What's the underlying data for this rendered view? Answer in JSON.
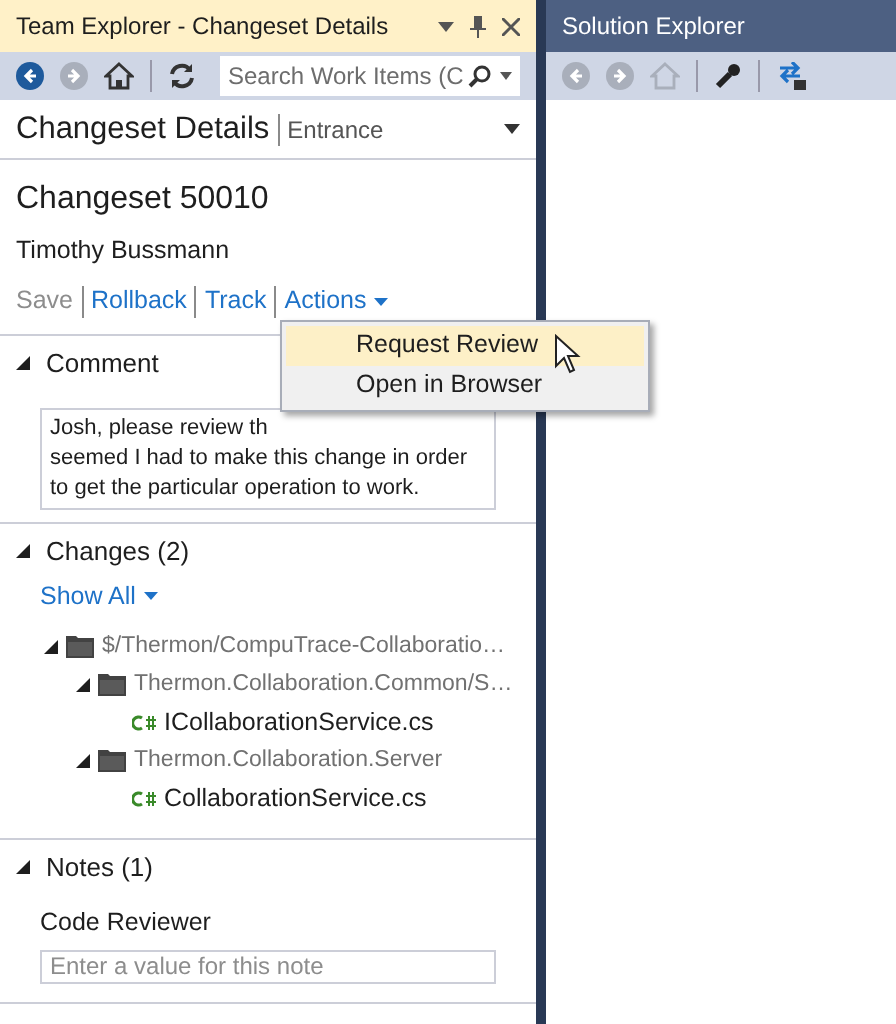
{
  "team_explorer": {
    "title": "Team Explorer - Changeset Details",
    "search": {
      "placeholder": "Search Work Items (C"
    },
    "page_title": "Changeset Details",
    "page_subtitle": "Entrance",
    "changeset": "Changeset 50010",
    "author": "Timothy Bussmann",
    "actions": [
      {
        "label": "Save",
        "disabled": true,
        "dropdown": false
      },
      {
        "label": "Rollback",
        "disabled": false,
        "dropdown": false
      },
      {
        "label": "Track",
        "disabled": false,
        "dropdown": false
      },
      {
        "label": "Actions",
        "disabled": false,
        "dropdown": true
      }
    ],
    "actions_menu": [
      {
        "label": "Request Review",
        "selected": true
      },
      {
        "label": "Open in Browser",
        "selected": false
      }
    ],
    "comment": {
      "title": "Comment",
      "expanded": true,
      "lines": [
        "Josh, please review th",
        "seemed I had to make this change in order",
        "to get the particular operation to work."
      ]
    },
    "changes": {
      "title": "Changes (2)",
      "expanded": true,
      "show_all": "Show All",
      "tree": [
        {
          "kind": "folder",
          "label": "$/Thermon/CompuTrace-Collaboratio…",
          "expanded": true,
          "children": [
            {
              "kind": "folder",
              "label": "Thermon.Collaboration.Common/S…",
              "expanded": true,
              "children": [
                {
                  "kind": "file",
                  "label": "ICollaborationService.cs"
                }
              ]
            },
            {
              "kind": "folder",
              "label": "Thermon.Collaboration.Server",
              "expanded": true,
              "children": [
                {
                  "kind": "file",
                  "label": "CollaborationService.cs"
                }
              ]
            }
          ]
        }
      ]
    },
    "notes": {
      "title": "Notes (1)",
      "expanded": true,
      "field_label": "Code Reviewer",
      "placeholder": "Enter a value for this note"
    }
  },
  "solution_explorer": {
    "title": "Solution Explorer"
  }
}
